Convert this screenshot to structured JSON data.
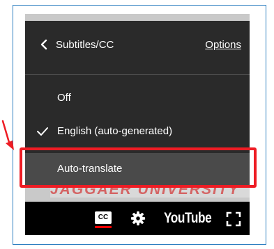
{
  "menu": {
    "title": "Subtitles/CC",
    "options_label": "Options",
    "back_icon": "chevron-left-icon",
    "items": [
      {
        "label": "Off",
        "selected": false
      },
      {
        "label": "English (auto-generated)",
        "selected": true
      },
      {
        "label": "Auto-translate",
        "selected": false,
        "highlighted": true
      }
    ]
  },
  "player": {
    "watermark_text": "JAGGAER UNIVERSITY",
    "cc_label": "CC",
    "logo_text": "YouTube",
    "icons": [
      "cc-icon",
      "gear-icon",
      "fullscreen-icon"
    ]
  },
  "annotation": {
    "highlight_color": "#ee1c24",
    "arrow_color": "#ee1c24"
  },
  "colors": {
    "menu_bg": "#2a2a2a",
    "highlight_row_bg": "#4a4a4a",
    "controls_bg": "#000000",
    "frame_border": "#2d7fc1",
    "cc_underline": "#ff0000"
  }
}
